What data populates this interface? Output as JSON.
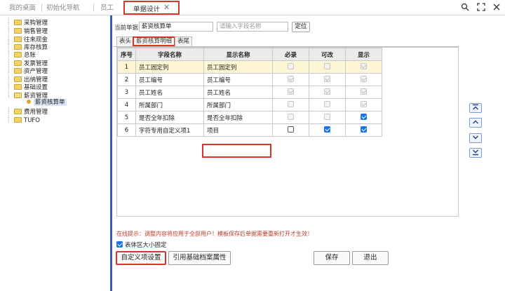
{
  "top_tabs": [
    {
      "label": "我的桌面"
    },
    {
      "label": "初始化导航"
    },
    {
      "label": "员工"
    },
    {
      "label": "单据设计",
      "active": true
    }
  ],
  "top_icons": [
    "search-icon",
    "fullscreen-icon",
    "close-icon"
  ],
  "tree": [
    {
      "label": "采购管理",
      "open": false
    },
    {
      "label": "销售管理",
      "open": false
    },
    {
      "label": "往来现金",
      "open": false
    },
    {
      "label": "库存核算",
      "open": false
    },
    {
      "label": "总账",
      "open": false
    },
    {
      "label": "发票管理",
      "open": false
    },
    {
      "label": "资产管理",
      "open": false
    },
    {
      "label": "出纳管理",
      "open": false
    },
    {
      "label": "基础设置",
      "open": false
    },
    {
      "label": "薪资管理",
      "open": true
    },
    {
      "label": "薪资核算单",
      "leaf": true,
      "selected": true
    },
    {
      "label": "费用管理",
      "open": false
    },
    {
      "label": "TUFO",
      "open": false
    }
  ],
  "current_doc": {
    "label": "当前单据",
    "value": "薪资核算单",
    "search_placeholder": "请输入字段名称",
    "locate_label": "定位"
  },
  "sub_tabs": [
    {
      "label": "表头"
    },
    {
      "label": "薪资核算明细",
      "active": true
    },
    {
      "label": "表尾"
    }
  ],
  "grid": {
    "columns": [
      "序号",
      "字段名称",
      "显示名称",
      "必录",
      "可改",
      "显示"
    ],
    "rows": [
      {
        "no": "1",
        "field": "员工固定列",
        "display": "员工固定列",
        "required": false,
        "editable": false,
        "show": true,
        "enabled": false
      },
      {
        "no": "2",
        "field": "员工编号",
        "display": "员工编号",
        "required": true,
        "editable": true,
        "show": true,
        "enabled": false
      },
      {
        "no": "3",
        "field": "员工姓名",
        "display": "员工姓名",
        "required": true,
        "editable": true,
        "show": true,
        "enabled": false
      },
      {
        "no": "4",
        "field": "所属部门",
        "display": "所属部门",
        "required": false,
        "editable": false,
        "show": true,
        "enabled": false
      },
      {
        "no": "5",
        "field": "是否全年扣除",
        "display": "是否全年扣除",
        "required": false,
        "editable": false,
        "show": true,
        "enabled": true
      },
      {
        "no": "6",
        "field": "字符专用自定义项1",
        "display": "项目",
        "required": false,
        "editable": true,
        "show": true,
        "enabled": true
      }
    ]
  },
  "hint": "在线提示：调整内容将应用于全部用户！模板保存后单据需要重新打开才生效！",
  "fix_size_label": "表体区大小固定",
  "buttons": {
    "custom": "自定义项设置",
    "reference": "引用基础档案属性",
    "save": "保存",
    "exit": "退出"
  },
  "move_buttons": [
    "move-top",
    "move-up",
    "move-down",
    "move-bottom"
  ]
}
